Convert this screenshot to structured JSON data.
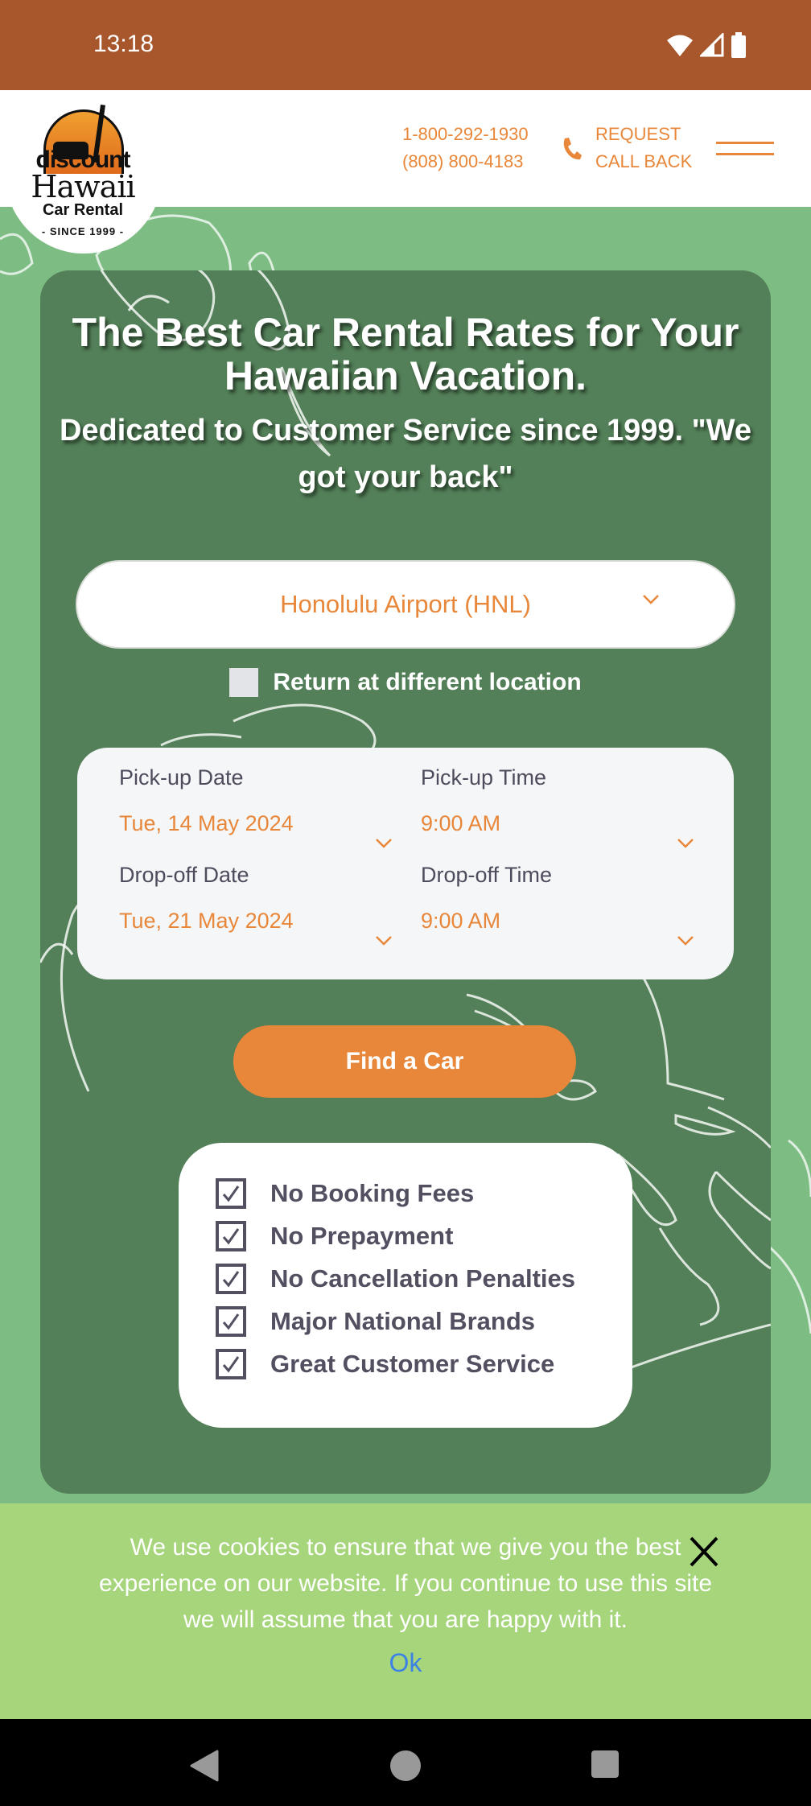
{
  "status_bar": {
    "time": "13:18",
    "icons": [
      "wifi-icon",
      "signal-icon",
      "battery-icon"
    ]
  },
  "header": {
    "logo": {
      "line1": "discount",
      "line2": "Hawaii",
      "line3": "Car Rental",
      "line4": "- SINCE 1999 -"
    },
    "phone_primary": "1-800-292-1930",
    "phone_secondary": "(808) 800-4183",
    "callback_line1": "REQUEST",
    "callback_line2": "CALL BACK",
    "menu_icon": "hamburger-icon"
  },
  "hero": {
    "title": "The Best Car Rental Rates for Your Hawaiian Vacation.",
    "subtitle": "Dedicated to Customer Service since 1999. \"We got your back\""
  },
  "search": {
    "location": "Honolulu Airport (HNL)",
    "return_different_label": "Return at different location",
    "return_different_checked": false,
    "pickup_date_label": "Pick-up Date",
    "pickup_date": "Tue, 14 May 2024",
    "pickup_time_label": "Pick-up Time",
    "pickup_time": "9:00 AM",
    "dropoff_date_label": "Drop-off Date",
    "dropoff_date": "Tue, 21 May 2024",
    "dropoff_time_label": "Drop-off Time",
    "dropoff_time": "9:00 AM",
    "submit_label": "Find a Car"
  },
  "features": [
    {
      "label": "No Booking Fees"
    },
    {
      "label": "No Prepayment"
    },
    {
      "label": "No Cancellation Penalties"
    },
    {
      "label": "Major National Brands"
    },
    {
      "label": "Great Customer Service"
    }
  ],
  "cookie": {
    "text": "We use cookies to ensure that we give you the best experience on our website. If you continue to use this site we will assume that you are happy with it.",
    "ok_label": "Ok",
    "close_label": "X"
  },
  "colors": {
    "status_bar": "#a8572c",
    "accent_orange": "#e8873a",
    "card_green": "#538058",
    "page_green": "#7dbd83",
    "cookie_green": "#a6d57c",
    "text_dark": "#534f60",
    "link_blue": "#3b82e6"
  }
}
